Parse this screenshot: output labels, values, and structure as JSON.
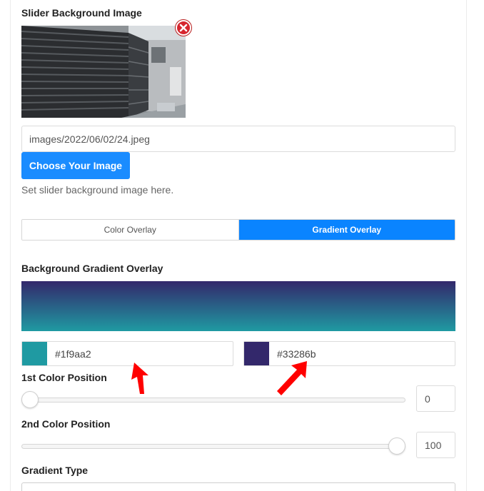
{
  "background_image": {
    "label": "Slider Background Image",
    "path_value": "images/2022/06/02/24.jpeg",
    "choose_button": "Choose Your Image",
    "help": "Set slider background image here."
  },
  "overlay_tabs": {
    "items": [
      {
        "label": "Color Overlay",
        "active": false
      },
      {
        "label": "Gradient Overlay",
        "active": true
      }
    ]
  },
  "gradient": {
    "label": "Background Gradient Overlay",
    "color1": {
      "hex": "#1f9aa2",
      "swatch": "#1f9aa2"
    },
    "color2": {
      "hex": "#33286b",
      "swatch": "#33286b"
    },
    "pos1": {
      "label": "1st Color Position",
      "value": "0",
      "percent": 0
    },
    "pos2": {
      "label": "2nd Color Position",
      "value": "100",
      "percent": 100
    },
    "type_label": "Gradient Type"
  },
  "colors": {
    "accent": "#1a8cff",
    "remove": "#d6262f",
    "annotation_arrow": "#ff0000"
  },
  "icons": {
    "remove": "close-circle-icon",
    "annotation": "red-arrow-icon"
  }
}
